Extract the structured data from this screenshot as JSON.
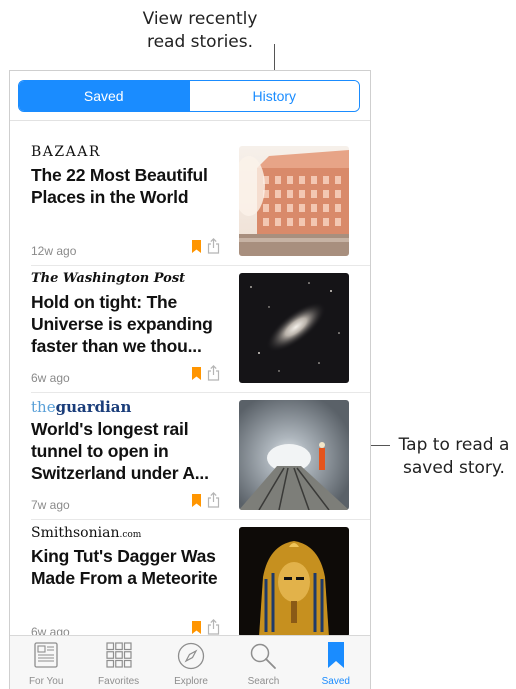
{
  "callouts": {
    "top_line1": "View recently",
    "top_line2": "read stories.",
    "right_line1": "Tap to read a",
    "right_line2": "saved story."
  },
  "segmented": {
    "saved_label": "Saved",
    "history_label": "History",
    "selected": "Saved"
  },
  "stories": [
    {
      "source": "BAZAAR",
      "headline": "The 22 Most Beautiful Places in the World",
      "age": "12w ago",
      "bookmark_icon": "bookmark-icon",
      "share_icon": "share-icon"
    },
    {
      "source": "The Washington Post",
      "headline": "Hold on tight: The Universe is expanding faster than we thou...",
      "age": "6w ago",
      "bookmark_icon": "bookmark-icon",
      "share_icon": "share-icon"
    },
    {
      "source_prefix": "the",
      "source": "guardian",
      "headline": "World's longest rail tunnel to open in Switzerland under A...",
      "age": "7w ago",
      "bookmark_icon": "bookmark-icon",
      "share_icon": "share-icon"
    },
    {
      "source": "Smithsonian",
      "source_suffix": ".com",
      "headline": "King Tut's Dagger Was Made From a Meteorite",
      "age": "6w ago",
      "bookmark_icon": "bookmark-icon",
      "share_icon": "share-icon"
    }
  ],
  "tabbar": {
    "items": [
      {
        "label": "For You",
        "icon": "for-you-icon"
      },
      {
        "label": "Favorites",
        "icon": "favorites-grid-icon"
      },
      {
        "label": "Explore",
        "icon": "compass-icon"
      },
      {
        "label": "Search",
        "icon": "search-icon"
      },
      {
        "label": "Saved",
        "icon": "bookmark-icon"
      }
    ],
    "active": "Saved"
  },
  "colors": {
    "accent": "#1a8cff",
    "bookmark": "#ff9500",
    "secondary_text": "#8a8a8a"
  }
}
